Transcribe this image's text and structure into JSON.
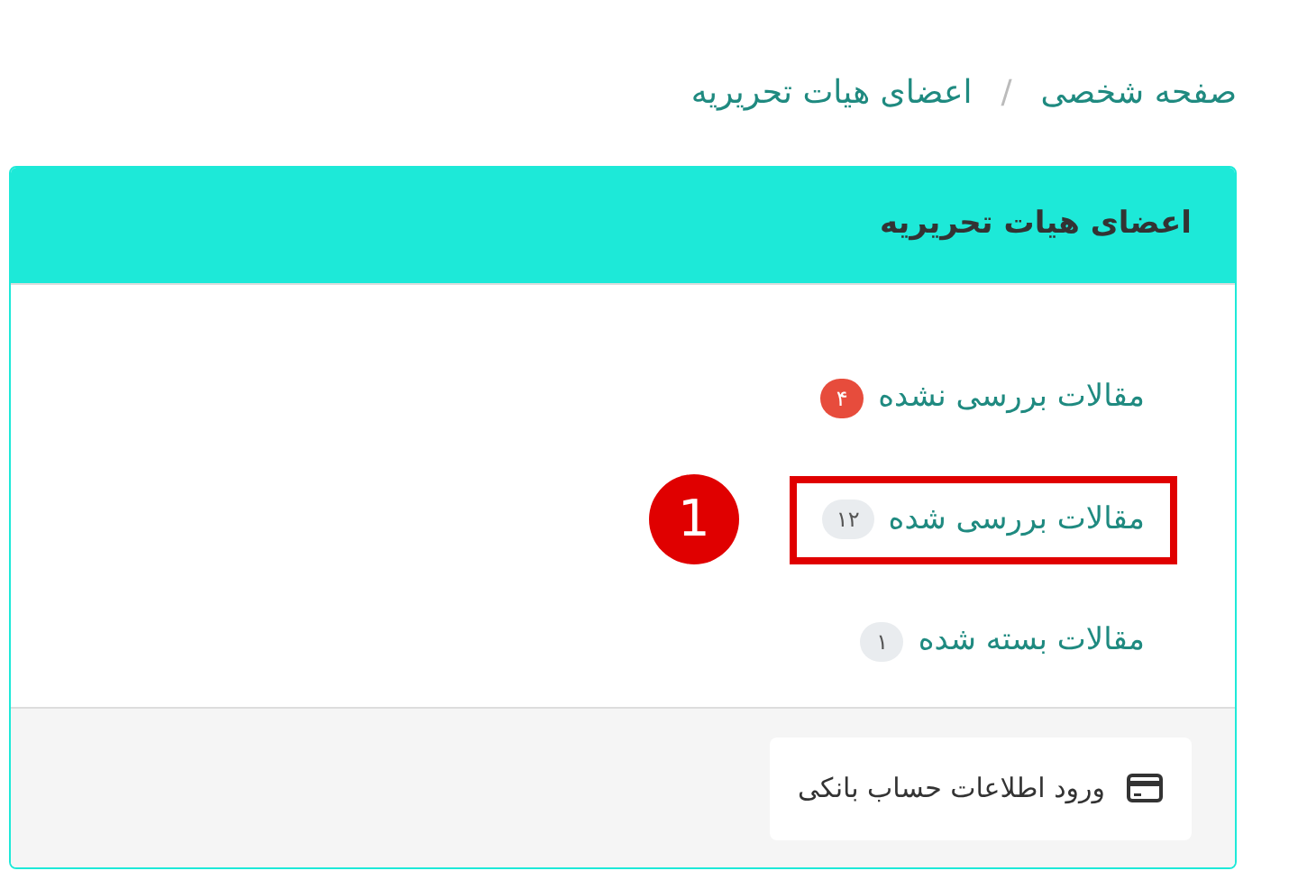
{
  "breadcrumb": [
    {
      "label": "صفحه شخصی"
    },
    {
      "label": "اعضای هیات تحریریه"
    }
  ],
  "breadcrumb_separator": "/",
  "card": {
    "title": "اعضای هیات تحریریه",
    "items": [
      {
        "label": "مقالات بررسی نشده",
        "count": "۴",
        "color": "#e74c3c"
      },
      {
        "label": "مقالات بررسی شده",
        "count": "۱۲",
        "color": "#e9ecef",
        "callout": "1"
      },
      {
        "label": "مقالات بسته شده",
        "count": "۱",
        "color": "#e9ecef"
      }
    ],
    "footer_button": {
      "label": "ورود اطلاعات حساب بانکی"
    }
  }
}
